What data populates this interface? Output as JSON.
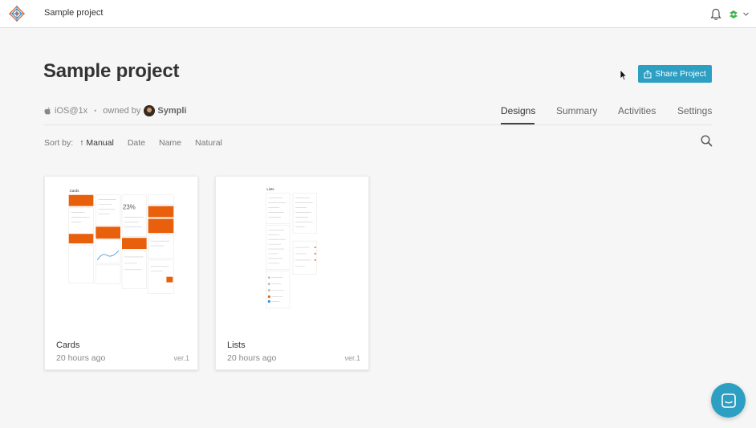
{
  "topbar": {
    "project_name": "Sample project",
    "logo_icon": "diamond-logo-icon",
    "notifications_icon": "bell-icon",
    "user_menu_icon": "user-avatar-icon"
  },
  "header": {
    "title": "Sample project",
    "share_label": "Share Project",
    "platform": "iOS@1x",
    "owned_by_label": "owned by",
    "owner_name": "Sympli"
  },
  "tabs": [
    {
      "label": "Designs",
      "active": true
    },
    {
      "label": "Summary",
      "active": false
    },
    {
      "label": "Activities",
      "active": false
    },
    {
      "label": "Settings",
      "active": false
    }
  ],
  "sort": {
    "label": "Sort by:",
    "options": [
      {
        "label": "Manual",
        "active": true
      },
      {
        "label": "Date",
        "active": false
      },
      {
        "label": "Name",
        "active": false
      },
      {
        "label": "Natural",
        "active": false
      }
    ]
  },
  "designs": [
    {
      "name": "Cards",
      "time": "20 hours ago",
      "version": "ver.1"
    },
    {
      "name": "Lists",
      "time": "20 hours ago",
      "version": "ver.1"
    }
  ],
  "colors": {
    "accent": "#2d9fc2",
    "orange": "#e8600c",
    "background": "#f6f6f6"
  }
}
